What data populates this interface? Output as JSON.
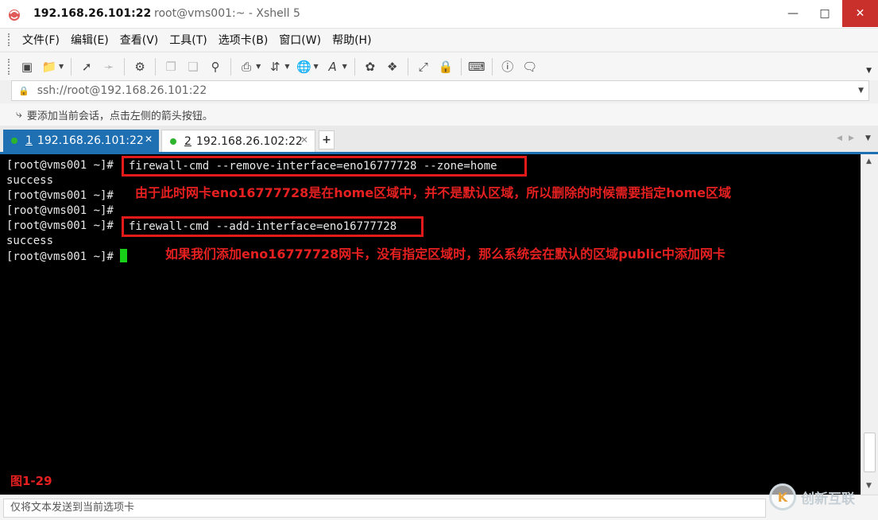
{
  "window": {
    "host": "192.168.26.101:22",
    "subtitle": "root@vms001:~ - Xshell 5",
    "minimize_icon": "minimize-icon",
    "maximize_icon": "maximize-icon",
    "close_icon": "close-icon",
    "close_color": "#c9302c"
  },
  "menu": {
    "items": [
      "文件(F)",
      "编辑(E)",
      "查看(V)",
      "工具(T)",
      "选项卡(B)",
      "窗口(W)",
      "帮助(H)"
    ]
  },
  "toolbar": {
    "icons": [
      "new-session-icon",
      "open-folder-icon",
      "connect-icon",
      "disconnect-icon",
      "properties-icon",
      "copy-icon",
      "paste-icon",
      "find-icon",
      "print-icon",
      "transfer-icon",
      "web-icon",
      "font-icon",
      "xftp-icon",
      "xmanager-icon",
      "fullscreen-icon",
      "lock-icon",
      "keyboard-icon",
      "help-icon",
      "chat-icon"
    ]
  },
  "address": {
    "url": "ssh://root@192.168.26.101:22"
  },
  "hint": {
    "text": "要添加当前会话，点击左侧的箭头按钮。"
  },
  "tabs": [
    {
      "num": "1",
      "label": "192.168.26.101:22",
      "status_color": "#2db52d",
      "active": true
    },
    {
      "num": "2",
      "label": "192.168.26.102:22",
      "status_color": "#2db52d",
      "active": false
    }
  ],
  "terminal": {
    "prompt": "[root@vms001 ~]#",
    "cmd1": "firewall-cmd --remove-interface=eno16777728 --zone=home",
    "out1": "success",
    "cmd2": "firewall-cmd --add-interface=eno16777728",
    "out2": "success",
    "cursor_color": "#19d019"
  },
  "annotations": {
    "note1": "由于此时网卡eno16777728是在home区域中，并不是默认区域，所以删除的时候需要指定home区域",
    "note2": "如果我们添加eno16777728网卡，没有指定区域时，那么系统会在默认的区域public中添加网卡",
    "figure": "图1-29",
    "color": "#e62020"
  },
  "status": {
    "placeholder": "仅将文本发送到当前选项卡"
  },
  "watermark": {
    "text": "创新互联"
  }
}
